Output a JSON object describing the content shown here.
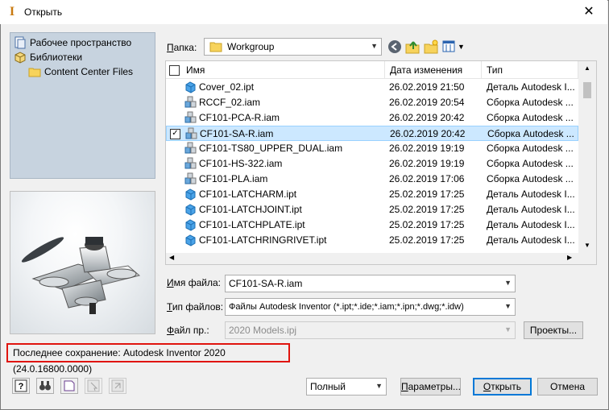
{
  "window": {
    "title": "Открыть"
  },
  "places": [
    {
      "label": "Рабочее пространство",
      "icon": "workspace-icon"
    },
    {
      "label": "Библиотеки",
      "icon": "libraries-icon"
    },
    {
      "label": "Content Center Files",
      "icon": "folder-icon"
    }
  ],
  "folder": {
    "label_u": "П",
    "label_rest": "апка:",
    "value": "Workgroup"
  },
  "columns": {
    "name": "Имя",
    "date": "Дата изменения",
    "type": "Тип"
  },
  "files": [
    {
      "name": "Cover_02.ipt",
      "date": "26.02.2019 21:50",
      "type": "Деталь Autodesk I...",
      "kind": "part",
      "selected": false
    },
    {
      "name": "RCCF_02.iam",
      "date": "26.02.2019 20:54",
      "type": "Сборка Autodesk ...",
      "kind": "assembly",
      "selected": false
    },
    {
      "name": "CF101-PCA-R.iam",
      "date": "26.02.2019 20:42",
      "type": "Сборка Autodesk ...",
      "kind": "assembly",
      "selected": false
    },
    {
      "name": "CF101-SA-R.iam",
      "date": "26.02.2019 20:42",
      "type": "Сборка Autodesk ...",
      "kind": "assembly",
      "selected": true
    },
    {
      "name": "CF101-TS80_UPPER_DUAL.iam",
      "date": "26.02.2019 19:19",
      "type": "Сборка Autodesk ...",
      "kind": "assembly",
      "selected": false
    },
    {
      "name": "CF101-HS-322.iam",
      "date": "26.02.2019 19:19",
      "type": "Сборка Autodesk ...",
      "kind": "assembly",
      "selected": false
    },
    {
      "name": "CF101-PLA.iam",
      "date": "26.02.2019 17:06",
      "type": "Сборка Autodesk ...",
      "kind": "assembly",
      "selected": false
    },
    {
      "name": "CF101-LATCHARM.ipt",
      "date": "25.02.2019 17:25",
      "type": "Деталь Autodesk I...",
      "kind": "part",
      "selected": false
    },
    {
      "name": "CF101-LATCHJOINT.ipt",
      "date": "25.02.2019 17:25",
      "type": "Деталь Autodesk I...",
      "kind": "part",
      "selected": false
    },
    {
      "name": "CF101-LATCHPLATE.ipt",
      "date": "25.02.2019 17:25",
      "type": "Деталь Autodesk I...",
      "kind": "part",
      "selected": false
    },
    {
      "name": "CF101-LATCHRINGRIVET.ipt",
      "date": "25.02.2019 17:25",
      "type": "Деталь Autodesk I...",
      "kind": "part",
      "selected": false
    }
  ],
  "filename": {
    "label_u": "И",
    "label_rest": "мя файла:",
    "value": "CF101-SA-R.iam"
  },
  "filetype": {
    "label_u": "Т",
    "label_rest": "ип файлов:",
    "value": "Файлы Autodesk Inventor (*.ipt;*.ide;*.iam;*.ipn;*.dwg;*.idw)"
  },
  "project": {
    "label_u": "Ф",
    "label_rest": "айл пр.:",
    "value": "2020 Models.ipj",
    "button": "Проекты..."
  },
  "status": {
    "text": "Последнее сохранение: Autodesk Inventor 2020 (24.0.16800.0000)"
  },
  "bottom": {
    "mode": "Полный",
    "params_u": "П",
    "params_rest": "араметры...",
    "open_u": "О",
    "open_rest": "ткрыть",
    "cancel": "Отмена"
  },
  "colors": {
    "accent": "#0078d7",
    "highlight": "#cce8ff",
    "status_border": "#e0140e"
  }
}
